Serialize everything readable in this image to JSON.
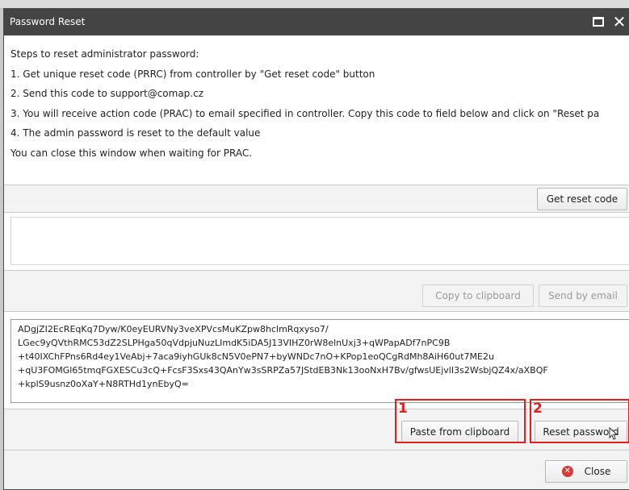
{
  "dialog": {
    "title": "Password Reset",
    "maximize_icon": "maximize-icon",
    "close_icon_glyph": "✕"
  },
  "steps": [
    "Steps to reset administrator password:",
    "1. Get unique reset code (PRRC) from controller by \"Get reset code\" button",
    "2. Send this code to support@comap.cz",
    "3. You will receive action code (PRAC) to email specified in controller. Copy this code to field below and click on \"Reset pa",
    "4. The admin password is reset to the default value",
    "You can close this window when waiting for PRAC."
  ],
  "buttons": {
    "get_reset_code": "Get reset code",
    "copy_to_clipboard": "Copy to clipboard",
    "send_by_email": "Send by email",
    "paste_from_clipboard": "Paste from clipboard",
    "reset_password": "Reset password",
    "close": "Close"
  },
  "reset_code_value": "",
  "prac_lines": [
    "ADgjZI2EcREqKq7Dyw/K0eyEURVNy3veXPVcsMuKZpw8hclmRqxyso7/",
    "LGec9yQVthRMC53dZ2SLPHga50qVdpjuNuzLImdK5iDA5J13VIHZ0rW8elnUxj3+qWPapADf7nPC9B",
    "+t40IXChFPns6Rd4ey1VeAbj+7aca9iyhGUk8cN5V0ePN7+byWNDc7nO+KPop1eoQCgRdMh8AiH60ut7ME2u",
    "+qU3FOMGl65tmqFGXESCu3cQ+FcsF3Sxs43QAnYw3sSRPZa57JStdEB3Nk13ooNxH7Bv/gfwsUEjvlI3s2WsbjQZ4x/aXBQF",
    "+kplS9usnz0oXaY+N8RTHd1ynEbyQ="
  ],
  "annotations": {
    "marker_1": "1",
    "marker_2": "2",
    "color": "#e01f1f"
  },
  "colors": {
    "titlebar": "#444444",
    "band": "#f3f3f3",
    "close_icon": "#d83a3a"
  }
}
